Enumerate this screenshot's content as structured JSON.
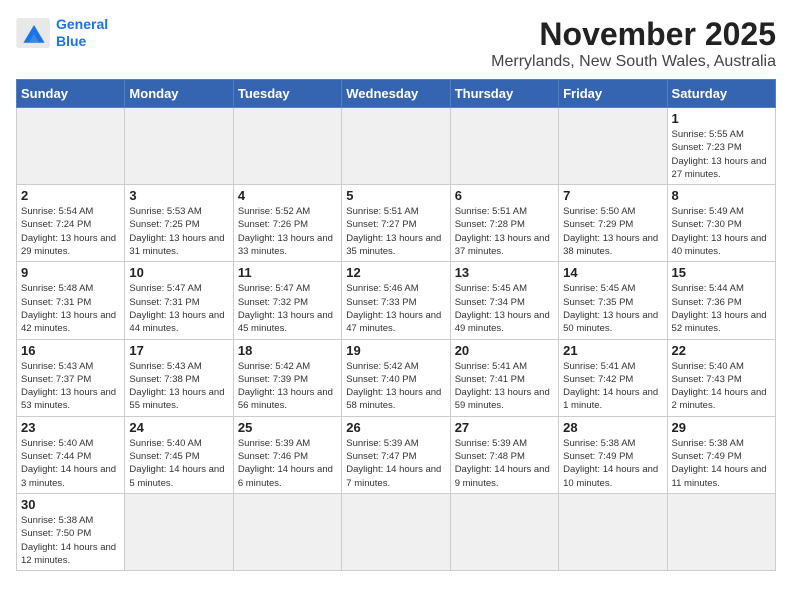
{
  "logo": {
    "line1": "General",
    "line2": "Blue"
  },
  "title": "November 2025",
  "location": "Merrylands, New South Wales, Australia",
  "weekdays": [
    "Sunday",
    "Monday",
    "Tuesday",
    "Wednesday",
    "Thursday",
    "Friday",
    "Saturday"
  ],
  "weeks": [
    [
      {
        "day": "",
        "info": ""
      },
      {
        "day": "",
        "info": ""
      },
      {
        "day": "",
        "info": ""
      },
      {
        "day": "",
        "info": ""
      },
      {
        "day": "",
        "info": ""
      },
      {
        "day": "",
        "info": ""
      },
      {
        "day": "1",
        "info": "Sunrise: 5:55 AM\nSunset: 7:23 PM\nDaylight: 13 hours and 27 minutes."
      }
    ],
    [
      {
        "day": "2",
        "info": "Sunrise: 5:54 AM\nSunset: 7:24 PM\nDaylight: 13 hours and 29 minutes."
      },
      {
        "day": "3",
        "info": "Sunrise: 5:53 AM\nSunset: 7:25 PM\nDaylight: 13 hours and 31 minutes."
      },
      {
        "day": "4",
        "info": "Sunrise: 5:52 AM\nSunset: 7:26 PM\nDaylight: 13 hours and 33 minutes."
      },
      {
        "day": "5",
        "info": "Sunrise: 5:51 AM\nSunset: 7:27 PM\nDaylight: 13 hours and 35 minutes."
      },
      {
        "day": "6",
        "info": "Sunrise: 5:51 AM\nSunset: 7:28 PM\nDaylight: 13 hours and 37 minutes."
      },
      {
        "day": "7",
        "info": "Sunrise: 5:50 AM\nSunset: 7:29 PM\nDaylight: 13 hours and 38 minutes."
      },
      {
        "day": "8",
        "info": "Sunrise: 5:49 AM\nSunset: 7:30 PM\nDaylight: 13 hours and 40 minutes."
      }
    ],
    [
      {
        "day": "9",
        "info": "Sunrise: 5:48 AM\nSunset: 7:31 PM\nDaylight: 13 hours and 42 minutes."
      },
      {
        "day": "10",
        "info": "Sunrise: 5:47 AM\nSunset: 7:31 PM\nDaylight: 13 hours and 44 minutes."
      },
      {
        "day": "11",
        "info": "Sunrise: 5:47 AM\nSunset: 7:32 PM\nDaylight: 13 hours and 45 minutes."
      },
      {
        "day": "12",
        "info": "Sunrise: 5:46 AM\nSunset: 7:33 PM\nDaylight: 13 hours and 47 minutes."
      },
      {
        "day": "13",
        "info": "Sunrise: 5:45 AM\nSunset: 7:34 PM\nDaylight: 13 hours and 49 minutes."
      },
      {
        "day": "14",
        "info": "Sunrise: 5:45 AM\nSunset: 7:35 PM\nDaylight: 13 hours and 50 minutes."
      },
      {
        "day": "15",
        "info": "Sunrise: 5:44 AM\nSunset: 7:36 PM\nDaylight: 13 hours and 52 minutes."
      }
    ],
    [
      {
        "day": "16",
        "info": "Sunrise: 5:43 AM\nSunset: 7:37 PM\nDaylight: 13 hours and 53 minutes."
      },
      {
        "day": "17",
        "info": "Sunrise: 5:43 AM\nSunset: 7:38 PM\nDaylight: 13 hours and 55 minutes."
      },
      {
        "day": "18",
        "info": "Sunrise: 5:42 AM\nSunset: 7:39 PM\nDaylight: 13 hours and 56 minutes."
      },
      {
        "day": "19",
        "info": "Sunrise: 5:42 AM\nSunset: 7:40 PM\nDaylight: 13 hours and 58 minutes."
      },
      {
        "day": "20",
        "info": "Sunrise: 5:41 AM\nSunset: 7:41 PM\nDaylight: 13 hours and 59 minutes."
      },
      {
        "day": "21",
        "info": "Sunrise: 5:41 AM\nSunset: 7:42 PM\nDaylight: 14 hours and 1 minute."
      },
      {
        "day": "22",
        "info": "Sunrise: 5:40 AM\nSunset: 7:43 PM\nDaylight: 14 hours and 2 minutes."
      }
    ],
    [
      {
        "day": "23",
        "info": "Sunrise: 5:40 AM\nSunset: 7:44 PM\nDaylight: 14 hours and 3 minutes."
      },
      {
        "day": "24",
        "info": "Sunrise: 5:40 AM\nSunset: 7:45 PM\nDaylight: 14 hours and 5 minutes."
      },
      {
        "day": "25",
        "info": "Sunrise: 5:39 AM\nSunset: 7:46 PM\nDaylight: 14 hours and 6 minutes."
      },
      {
        "day": "26",
        "info": "Sunrise: 5:39 AM\nSunset: 7:47 PM\nDaylight: 14 hours and 7 minutes."
      },
      {
        "day": "27",
        "info": "Sunrise: 5:39 AM\nSunset: 7:48 PM\nDaylight: 14 hours and 9 minutes."
      },
      {
        "day": "28",
        "info": "Sunrise: 5:38 AM\nSunset: 7:49 PM\nDaylight: 14 hours and 10 minutes."
      },
      {
        "day": "29",
        "info": "Sunrise: 5:38 AM\nSunset: 7:49 PM\nDaylight: 14 hours and 11 minutes."
      }
    ],
    [
      {
        "day": "30",
        "info": "Sunrise: 5:38 AM\nSunset: 7:50 PM\nDaylight: 14 hours and 12 minutes."
      },
      {
        "day": "",
        "info": ""
      },
      {
        "day": "",
        "info": ""
      },
      {
        "day": "",
        "info": ""
      },
      {
        "day": "",
        "info": ""
      },
      {
        "day": "",
        "info": ""
      },
      {
        "day": "",
        "info": ""
      }
    ]
  ]
}
